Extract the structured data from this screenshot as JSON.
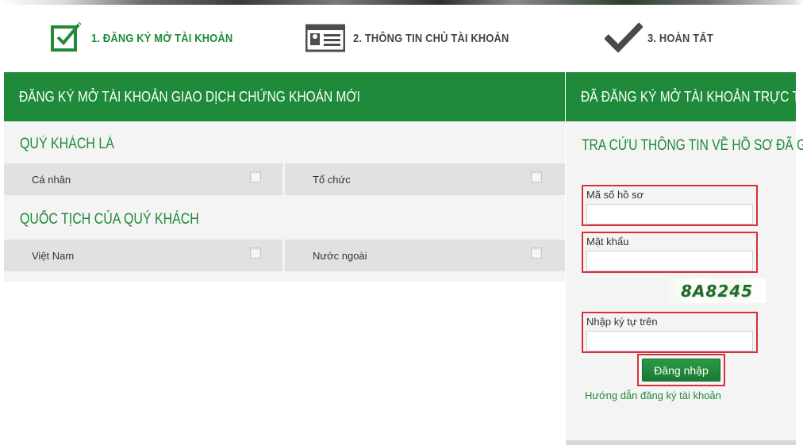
{
  "steps": [
    {
      "label": "1. ĐĂNG KÝ MỞ TÀI KHOẢN",
      "icon": "edit-checkbox-icon"
    },
    {
      "label": "2. THÔNG TIN CHỦ TÀI KHOẢN",
      "icon": "id-card-icon"
    },
    {
      "label": "3. HOÀN TẤT",
      "icon": "checkmark-icon"
    }
  ],
  "main": {
    "header": "ĐĂNG KÝ MỞ TÀI KHOẢN GIAO DỊCH CHỨNG KHOÁN MỚI",
    "customer_type": {
      "title": "QUÝ KHÁCH LÀ",
      "options": [
        "Cá nhân",
        "Tổ chức"
      ]
    },
    "nationality": {
      "title": "QUỐC TỊCH CỦA QUÝ KHÁCH",
      "options": [
        "Việt Nam",
        "Nước ngoài"
      ]
    }
  },
  "sidebar": {
    "header": "ĐÃ ĐĂNG KÝ MỞ TÀI KHOẢN TRỰC TUYẾN",
    "title": "TRA CỨU THÔNG TIN VỀ HỒ SƠ ĐÃ GỬI",
    "fields": [
      {
        "label": "Mã số hồ sơ",
        "value": ""
      },
      {
        "label": "Mật khẩu",
        "value": ""
      },
      {
        "label": "Nhập ký tự trên",
        "value": ""
      }
    ],
    "captcha": "8A8245",
    "login_label": "Đăng nhập",
    "guide_link": "Hướng dẫn đăng ký tài khoản"
  },
  "colors": {
    "brand_green": "#1e8a3a",
    "highlight_red": "#d62f3a",
    "panel_bg": "#f4f4f4",
    "option_bg": "#e1e1e1"
  }
}
